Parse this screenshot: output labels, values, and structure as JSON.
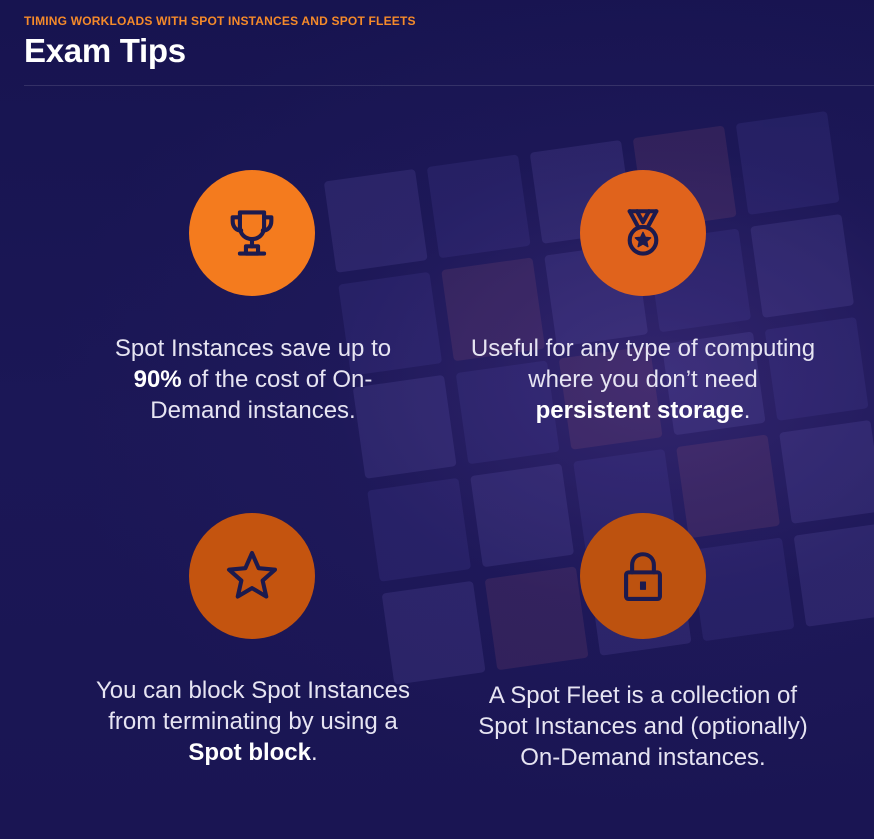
{
  "header": {
    "eyebrow": "TIMING WORKLOADS WITH SPOT INSTANCES AND SPOT FLEETS",
    "title": "Exam Tips"
  },
  "tips": [
    {
      "icon": "trophy-icon",
      "color": "#f47b1e",
      "before": "Spot Instances save up to ",
      "bold": "90%",
      "after": " of the cost of On-Demand instances."
    },
    {
      "icon": "medal-icon",
      "color": "#e0631c",
      "before": "Useful for any type of computing where you don’t need ",
      "bold": "persistent storage",
      "after": "."
    },
    {
      "icon": "star-icon",
      "color": "#c4540f",
      "before": "You can block Spot Instances from terminating by using a ",
      "bold": "Spot block",
      "after": "."
    },
    {
      "icon": "lock-icon",
      "color": "#bd520f",
      "before": "A Spot Fleet is a collection of Spot Instances and (optionally) On-Demand instances.",
      "bold": "",
      "after": ""
    }
  ],
  "colors": {
    "background": "#1a1653",
    "accent": "#f58a2a",
    "icon_stroke": "#1c1a4e"
  }
}
